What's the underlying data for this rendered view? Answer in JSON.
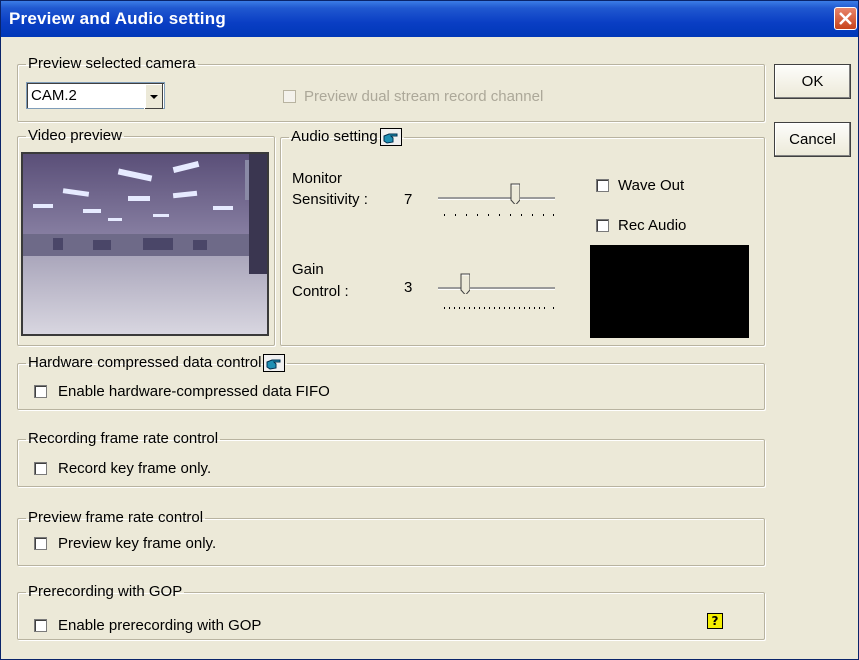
{
  "window": {
    "title": "Preview and Audio setting"
  },
  "buttons": {
    "ok": "OK",
    "cancel": "Cancel"
  },
  "preview_camera": {
    "legend": "Preview selected camera",
    "camera_value": "CAM.2",
    "dual_stream_label": "Preview dual stream record channel",
    "dual_stream_checked": false,
    "dual_stream_enabled": false
  },
  "video_preview": {
    "legend": "Video preview"
  },
  "audio": {
    "legend": "Audio setting",
    "monitor_label_1": "Monitor",
    "monitor_label_2": "Sensitivity :",
    "monitor_value": "7",
    "gain_label_1": "Gain",
    "gain_label_2": "Control :",
    "gain_value": "3",
    "wave_out_label": "Wave Out",
    "wave_out_checked": false,
    "rec_audio_label": "Rec Audio",
    "rec_audio_checked": false
  },
  "hardware": {
    "legend": "Hardware compressed data control",
    "fifo_label": "Enable hardware-compressed data FIFO",
    "fifo_checked": false
  },
  "recording_rate": {
    "legend": "Recording frame rate control",
    "keyframe_label": "Record key frame only.",
    "keyframe_checked": false
  },
  "preview_rate": {
    "legend": "Preview frame rate control",
    "keyframe_label": "Preview key frame only.",
    "keyframe_checked": false
  },
  "prerecording": {
    "legend": "Prerecording with GOP",
    "enable_label": "Enable prerecording with GOP",
    "enable_checked": false,
    "help_glyph": "?"
  },
  "icons": {
    "close": "close-icon",
    "hand_pointer": "hand-pointer-icon",
    "help": "help-icon",
    "dropdown": "chevron-down-icon"
  },
  "colors": {
    "titlebar": "#0a3ec4",
    "window_bg": "#ece9d8",
    "close_button": "#d4552f"
  }
}
